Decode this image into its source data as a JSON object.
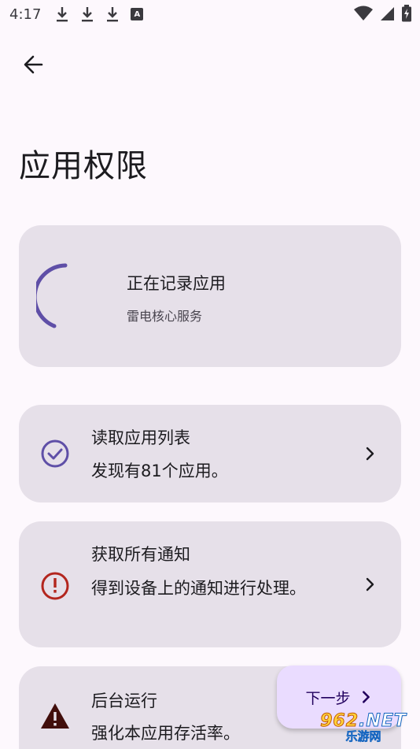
{
  "status_bar": {
    "time": "4:17",
    "left_icons": [
      "download-icon",
      "download-icon",
      "download-icon",
      "a-badge-icon"
    ],
    "a_badge_text": "A",
    "right_icons": [
      "wifi-icon",
      "signal-icon",
      "battery-icon"
    ]
  },
  "header": {
    "back_icon": "arrow-back-icon",
    "title": "应用权限"
  },
  "recording_card": {
    "title": "正在记录应用",
    "subtitle": "雷电核心服务",
    "spinner_color": "#5f4fa7"
  },
  "permissions": [
    {
      "icon": "check-circle-icon",
      "icon_color": "#5f4fa7",
      "title": "读取应用列表",
      "desc": "发现有81个应用。"
    },
    {
      "icon": "error-circle-icon",
      "icon_color": "#b3261e",
      "title": "获取所有通知",
      "desc": "得到设备上的通知进行处理。"
    },
    {
      "icon": "warning-triangle-icon",
      "icon_color": "#410e0b",
      "title": "后台运行",
      "desc": "强化本应用存活率。"
    }
  ],
  "next_button": {
    "label": "下一步",
    "icon": "chevron-right-icon"
  },
  "watermark": {
    "num": "962",
    "dot_net": ".NET",
    "sub": "乐游网"
  },
  "colors": {
    "background": "#fdf8fd",
    "card": "#e6e0e9",
    "accent": "#5f4fa7",
    "next_button": "#eadcff"
  }
}
